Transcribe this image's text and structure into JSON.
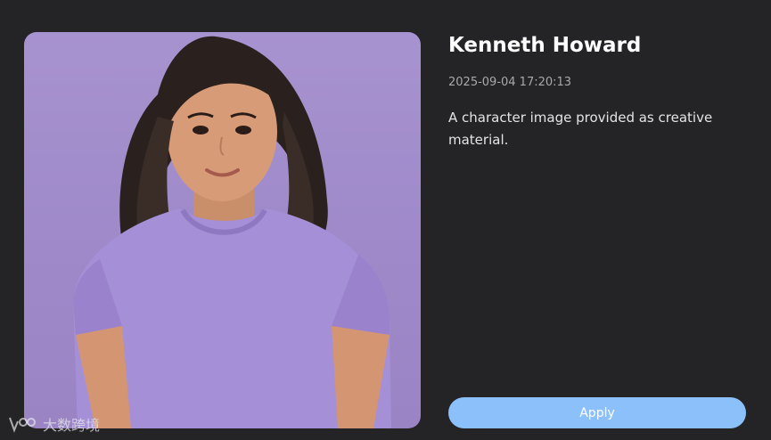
{
  "profile": {
    "name": "Kenneth Howard",
    "timestamp": "2025-09-04 17:20:13",
    "description": "A character image provided as creative material."
  },
  "actions": {
    "apply_label": "Apply"
  },
  "watermark": {
    "text": "大数跨境"
  },
  "colors": {
    "background": "#242426",
    "accent": "#8cc0fb",
    "image_backdrop": "#a793cf",
    "shirt": "#a58fd6"
  },
  "icons": {
    "watermark_logo": "watermark-logo-icon"
  }
}
